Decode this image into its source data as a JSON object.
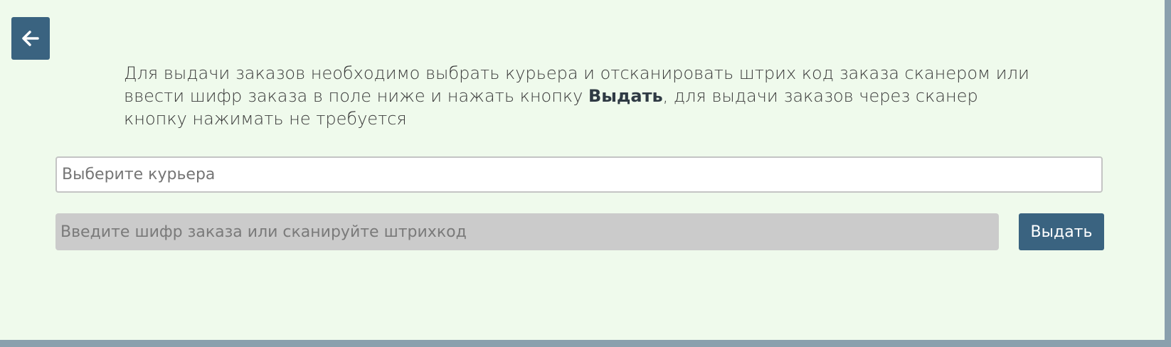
{
  "header": {
    "back_icon": "arrow-left-icon"
  },
  "instructions": {
    "line1": "Для выдачи заказов необходимо выбрать курьера и отсканировать штрих код заказа сканером или",
    "line2_before": "ввести шифр заказа в поле ниже и нажать кнопку ",
    "line2_bold": "Выдать",
    "line2_after": ", для выдачи заказов через сканер",
    "line3": "кнопку нажимать не требуется"
  },
  "form": {
    "courier_placeholder": "Выберите курьера",
    "code_placeholder": "Введите шифр заказа или сканируйте штрихкод",
    "issue_label": "Выдать"
  },
  "colors": {
    "background": "#effaec",
    "accent": "#3a6380",
    "frame": "#8aa0ad"
  }
}
